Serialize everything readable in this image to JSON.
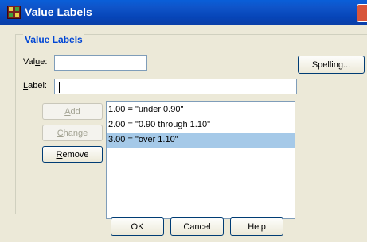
{
  "window": {
    "title": "Value Labels"
  },
  "group": {
    "label": "Value Labels"
  },
  "value_field": {
    "label_pre": "Val",
    "label_accel": "u",
    "label_post": "e:",
    "value": ""
  },
  "label_field": {
    "label_accel": "L",
    "label_post": "abel:",
    "value": ""
  },
  "buttons": {
    "spelling": "Spelling...",
    "add": {
      "accel": "A",
      "rest": "dd"
    },
    "change": {
      "accel": "C",
      "rest": "hange"
    },
    "remove": {
      "accel": "R",
      "rest": "emove"
    },
    "ok": "OK",
    "cancel": "Cancel",
    "help": "Help"
  },
  "list": {
    "items": [
      "1.00 = \"under 0.90\"",
      "2.00 = \"0.90 through 1.10\"",
      "3.00 = \"over 1.10\""
    ],
    "selected_index": 2
  },
  "colors": {
    "titlebar": "#0a5fd8",
    "selection": "#a5c9e8",
    "group_label": "#0046d5"
  }
}
